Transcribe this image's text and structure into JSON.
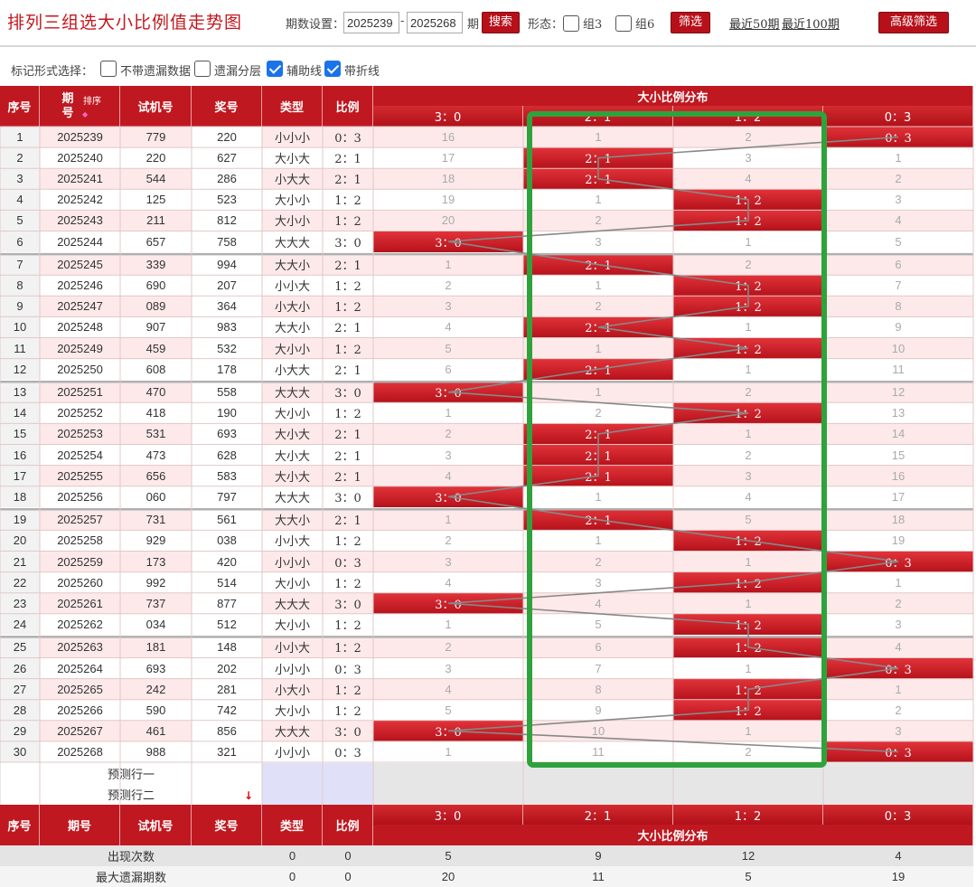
{
  "title": "排列三组选大小比例值走势图",
  "filter": {
    "period_label": "期数设置：",
    "start": "2025239",
    "dash": "-",
    "end": "2025268",
    "period_unit": "期",
    "search_label": "搜索",
    "form_label": "形态：",
    "group3": "组3",
    "group6": "组6",
    "filter_label": "筛选",
    "recent50": "最近50期",
    "recent100": "最近100期",
    "advanced_label": "高级筛选"
  },
  "mark": {
    "label": "标记形式选择：",
    "options": [
      {
        "label": "不带遗漏数据",
        "checked": false
      },
      {
        "label": "遗漏分层",
        "checked": false
      },
      {
        "label": "辅助线",
        "checked": true
      },
      {
        "label": "带折线",
        "checked": true
      }
    ]
  },
  "header": {
    "seq": "序号",
    "period_a": "期",
    "period_b": "号",
    "sort": "排序",
    "trial": "试机号",
    "prize": "奖号",
    "type": "类型",
    "ratio": "比例",
    "dist": "大小比例分布",
    "cols": [
      "3：0",
      "2：1",
      "1：2",
      "0：3"
    ]
  },
  "rows": [
    {
      "seq": "1",
      "period": "2025239",
      "trial": "779",
      "prize": "220",
      "type": "小小小",
      "ratio": "0：3",
      "cells": [
        "16",
        "1",
        "2",
        "0：3"
      ]
    },
    {
      "seq": "2",
      "period": "2025240",
      "trial": "220",
      "prize": "627",
      "type": "大小大",
      "ratio": "2：1",
      "cells": [
        "17",
        "2：1",
        "3",
        "1"
      ]
    },
    {
      "seq": "3",
      "period": "2025241",
      "trial": "544",
      "prize": "286",
      "type": "小大大",
      "ratio": "2：1",
      "cells": [
        "18",
        "2：1",
        "4",
        "2"
      ]
    },
    {
      "seq": "4",
      "period": "2025242",
      "trial": "125",
      "prize": "523",
      "type": "大小小",
      "ratio": "1：2",
      "cells": [
        "19",
        "1",
        "1：2",
        "3"
      ]
    },
    {
      "seq": "5",
      "period": "2025243",
      "trial": "211",
      "prize": "812",
      "type": "大小小",
      "ratio": "1：2",
      "cells": [
        "20",
        "2",
        "1：2",
        "4"
      ]
    },
    {
      "seq": "6",
      "period": "2025244",
      "trial": "657",
      "prize": "758",
      "type": "大大大",
      "ratio": "3：0",
      "cells": [
        "3：0",
        "3",
        "1",
        "5"
      ]
    },
    {
      "seq": "7",
      "period": "2025245",
      "trial": "339",
      "prize": "994",
      "type": "大大小",
      "ratio": "2：1",
      "cells": [
        "1",
        "2：1",
        "2",
        "6"
      ]
    },
    {
      "seq": "8",
      "period": "2025246",
      "trial": "690",
      "prize": "207",
      "type": "小小大",
      "ratio": "1：2",
      "cells": [
        "2",
        "1",
        "1：2",
        "7"
      ]
    },
    {
      "seq": "9",
      "period": "2025247",
      "trial": "089",
      "prize": "364",
      "type": "小大小",
      "ratio": "1：2",
      "cells": [
        "3",
        "2",
        "1：2",
        "8"
      ]
    },
    {
      "seq": "10",
      "period": "2025248",
      "trial": "907",
      "prize": "983",
      "type": "大大小",
      "ratio": "2：1",
      "cells": [
        "4",
        "2：1",
        "1",
        "9"
      ]
    },
    {
      "seq": "11",
      "period": "2025249",
      "trial": "459",
      "prize": "532",
      "type": "大小小",
      "ratio": "1：2",
      "cells": [
        "5",
        "1",
        "1：2",
        "10"
      ]
    },
    {
      "seq": "12",
      "period": "2025250",
      "trial": "608",
      "prize": "178",
      "type": "小大大",
      "ratio": "2：1",
      "cells": [
        "6",
        "2：1",
        "1",
        "11"
      ]
    },
    {
      "seq": "13",
      "period": "2025251",
      "trial": "470",
      "prize": "558",
      "type": "大大大",
      "ratio": "3：0",
      "cells": [
        "3：0",
        "1",
        "2",
        "12"
      ]
    },
    {
      "seq": "14",
      "period": "2025252",
      "trial": "418",
      "prize": "190",
      "type": "大小小",
      "ratio": "1：2",
      "cells": [
        "1",
        "2",
        "1：2",
        "13"
      ]
    },
    {
      "seq": "15",
      "period": "2025253",
      "trial": "531",
      "prize": "693",
      "type": "大小大",
      "ratio": "2：1",
      "cells": [
        "2",
        "2：1",
        "1",
        "14"
      ]
    },
    {
      "seq": "16",
      "period": "2025254",
      "trial": "473",
      "prize": "628",
      "type": "大小大",
      "ratio": "2：1",
      "cells": [
        "3",
        "2：1",
        "2",
        "15"
      ]
    },
    {
      "seq": "17",
      "period": "2025255",
      "trial": "656",
      "prize": "583",
      "type": "大小大",
      "ratio": "2：1",
      "cells": [
        "4",
        "2：1",
        "3",
        "16"
      ]
    },
    {
      "seq": "18",
      "period": "2025256",
      "trial": "060",
      "prize": "797",
      "type": "大大大",
      "ratio": "3：0",
      "cells": [
        "3：0",
        "1",
        "4",
        "17"
      ]
    },
    {
      "seq": "19",
      "period": "2025257",
      "trial": "731",
      "prize": "561",
      "type": "大大小",
      "ratio": "2：1",
      "cells": [
        "1",
        "2：1",
        "5",
        "18"
      ]
    },
    {
      "seq": "20",
      "period": "2025258",
      "trial": "929",
      "prize": "038",
      "type": "小小大",
      "ratio": "1：2",
      "cells": [
        "2",
        "1",
        "1：2",
        "19"
      ]
    },
    {
      "seq": "21",
      "period": "2025259",
      "trial": "173",
      "prize": "420",
      "type": "小小小",
      "ratio": "0：3",
      "cells": [
        "3",
        "2",
        "1",
        "0：3"
      ]
    },
    {
      "seq": "22",
      "period": "2025260",
      "trial": "992",
      "prize": "514",
      "type": "大小小",
      "ratio": "1：2",
      "cells": [
        "4",
        "3",
        "1：2",
        "1"
      ]
    },
    {
      "seq": "23",
      "period": "2025261",
      "trial": "737",
      "prize": "877",
      "type": "大大大",
      "ratio": "3：0",
      "cells": [
        "3：0",
        "4",
        "1",
        "2"
      ]
    },
    {
      "seq": "24",
      "period": "2025262",
      "trial": "034",
      "prize": "512",
      "type": "大小小",
      "ratio": "1：2",
      "cells": [
        "1",
        "5",
        "1：2",
        "3"
      ]
    },
    {
      "seq": "25",
      "period": "2025263",
      "trial": "181",
      "prize": "148",
      "type": "小小大",
      "ratio": "1：2",
      "cells": [
        "2",
        "6",
        "1：2",
        "4"
      ]
    },
    {
      "seq": "26",
      "period": "2025264",
      "trial": "693",
      "prize": "202",
      "type": "小小小",
      "ratio": "0：3",
      "cells": [
        "3",
        "7",
        "1",
        "0：3"
      ]
    },
    {
      "seq": "27",
      "period": "2025265",
      "trial": "242",
      "prize": "281",
      "type": "小大小",
      "ratio": "1：2",
      "cells": [
        "4",
        "8",
        "1：2",
        "1"
      ]
    },
    {
      "seq": "28",
      "period": "2025266",
      "trial": "590",
      "prize": "742",
      "type": "大小小",
      "ratio": "1：2",
      "cells": [
        "5",
        "9",
        "1：2",
        "2"
      ]
    },
    {
      "seq": "29",
      "period": "2025267",
      "trial": "461",
      "prize": "856",
      "type": "大大大",
      "ratio": "3：0",
      "cells": [
        "3：0",
        "10",
        "1",
        "3"
      ]
    },
    {
      "seq": "30",
      "period": "2025268",
      "trial": "988",
      "prize": "321",
      "type": "小小小",
      "ratio": "0：3",
      "cells": [
        "1",
        "11",
        "2",
        "0：3"
      ]
    }
  ],
  "predict": [
    "预测行一",
    "预测行二"
  ],
  "stats": [
    {
      "label": "出现次数",
      "type": "0",
      "ratio": "0",
      "cells": [
        "5",
        "9",
        "12",
        "4"
      ]
    },
    {
      "label": "最大遗漏期数",
      "type": "0",
      "ratio": "0",
      "cells": [
        "20",
        "11",
        "5",
        "19"
      ]
    }
  ],
  "colors": {
    "red": "#c01820",
    "highlight_box": "#2ea33c",
    "polyline": "#888888"
  }
}
